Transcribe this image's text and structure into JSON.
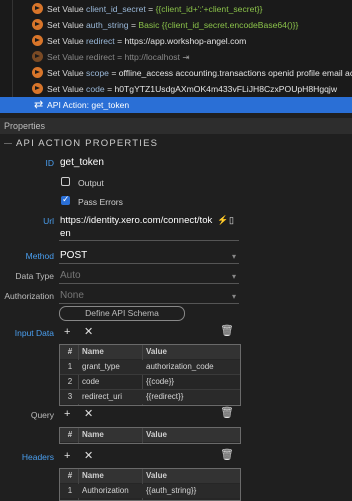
{
  "steps": [
    {
      "label": "Set Value",
      "key": "client_id_secret",
      "eq": "=",
      "value": "{{client_id+':'+client_secret}}",
      "dim": false
    },
    {
      "label": "Set Value",
      "key": "auth_string",
      "eq": "=",
      "value": "Basic {{client_id_secret.encodeBase64()}}",
      "dim": false
    },
    {
      "label": "Set Value",
      "key": "redirect",
      "eq": "=",
      "value": "https://app.workshop-angel.com",
      "dim": false
    },
    {
      "label": "Set Value",
      "key": "redirect",
      "eq": "=",
      "value": "http://localhost",
      "dim": true
    },
    {
      "label": "Set Value",
      "key": "scope",
      "eq": "=",
      "value": "offline_access accounting.transactions openid profile email accoun",
      "dim": false
    },
    {
      "label": "Set Value",
      "key": "code",
      "eq": "=",
      "value": "h0TgYTZ1UsdgAXmOK4m433vFLiJH8CzxPOUpH8Hgqjw",
      "dim": false
    }
  ],
  "selected_step": {
    "label": "API Action: get_token"
  },
  "properties_title": "Properties",
  "section_title": "API ACTION PROPERTIES",
  "fields": {
    "id_label": "ID",
    "id_value": "get_token",
    "output_label": "Output",
    "pass_errors_label": "Pass Errors",
    "url_label": "Url",
    "url_value_1": "https://identity.xero.com/connect/tok",
    "url_value_2": "en",
    "method_label": "Method",
    "method_value": "POST",
    "data_type_label": "Data Type",
    "data_type_value": "Auto",
    "authorization_label": "Authorization",
    "authorization_value": "None",
    "define_schema_label": "Define API Schema",
    "input_data_label": "Input Data",
    "query_label": "Query",
    "headers_label": "Headers"
  },
  "output_checked": false,
  "pass_errors_checked": true,
  "input_table": {
    "headers": [
      "#",
      "Name",
      "Value"
    ],
    "rows": [
      {
        "num": "1",
        "name": "grant_type",
        "value": "authorization_code"
      },
      {
        "num": "2",
        "name": "code",
        "value": "{{code}}"
      },
      {
        "num": "3",
        "name": "redirect_uri",
        "value": "{{redirect}}"
      }
    ]
  },
  "query_table": {
    "headers": [
      "#",
      "Name",
      "Value"
    ],
    "rows": []
  },
  "headers_table": {
    "headers": [
      "#",
      "Name",
      "Value"
    ],
    "rows": [
      {
        "num": "1",
        "name": "Authorization",
        "value": "{{auth_string}}"
      }
    ]
  },
  "colors": {
    "accent": "#2a6fd6",
    "label_blue": "#4a9ff0",
    "step_icon": "#d8752a",
    "expr_green": "#8bc34a"
  }
}
